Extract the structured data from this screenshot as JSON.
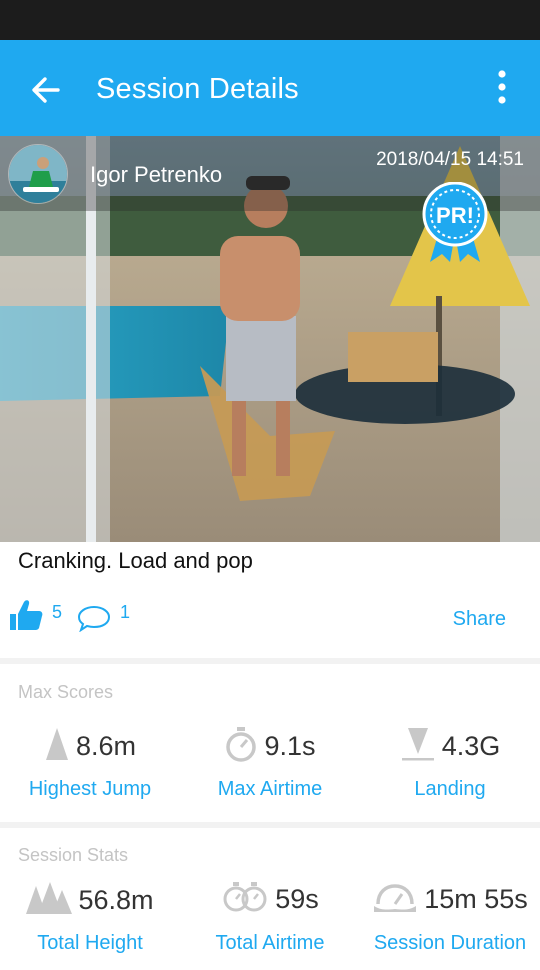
{
  "appbar": {
    "title": "Session Details",
    "back_icon": "arrow-left-icon",
    "more_icon": "more-vertical-icon"
  },
  "post": {
    "username": "Igor Petrenko",
    "datetime": "2018/04/15 14:51",
    "badge": "PR!",
    "caption": "Cranking. Load and pop"
  },
  "social": {
    "likes": "5",
    "comments": "1",
    "share_label": "Share"
  },
  "max_scores": {
    "label": "Max Scores",
    "items": [
      {
        "value": "8.6m",
        "label": "Highest Jump",
        "icon": "jump-height-icon"
      },
      {
        "value": "9.1s",
        "label": "Max Airtime",
        "icon": "stopwatch-icon"
      },
      {
        "value": "4.3G",
        "label": "Landing",
        "icon": "landing-icon"
      }
    ]
  },
  "session_stats": {
    "label": "Session Stats",
    "items": [
      {
        "value": "56.8m",
        "label": "Total Height",
        "icon": "total-height-icon"
      },
      {
        "value": "59s",
        "label": "Total Airtime",
        "icon": "double-stopwatch-icon"
      },
      {
        "value": "15m 55s",
        "label": "Session Duration",
        "icon": "duration-icon"
      }
    ]
  },
  "colors": {
    "accent": "#1fa9f0",
    "statusbar": "#1c1c1c",
    "muted": "#c4c4c4"
  }
}
